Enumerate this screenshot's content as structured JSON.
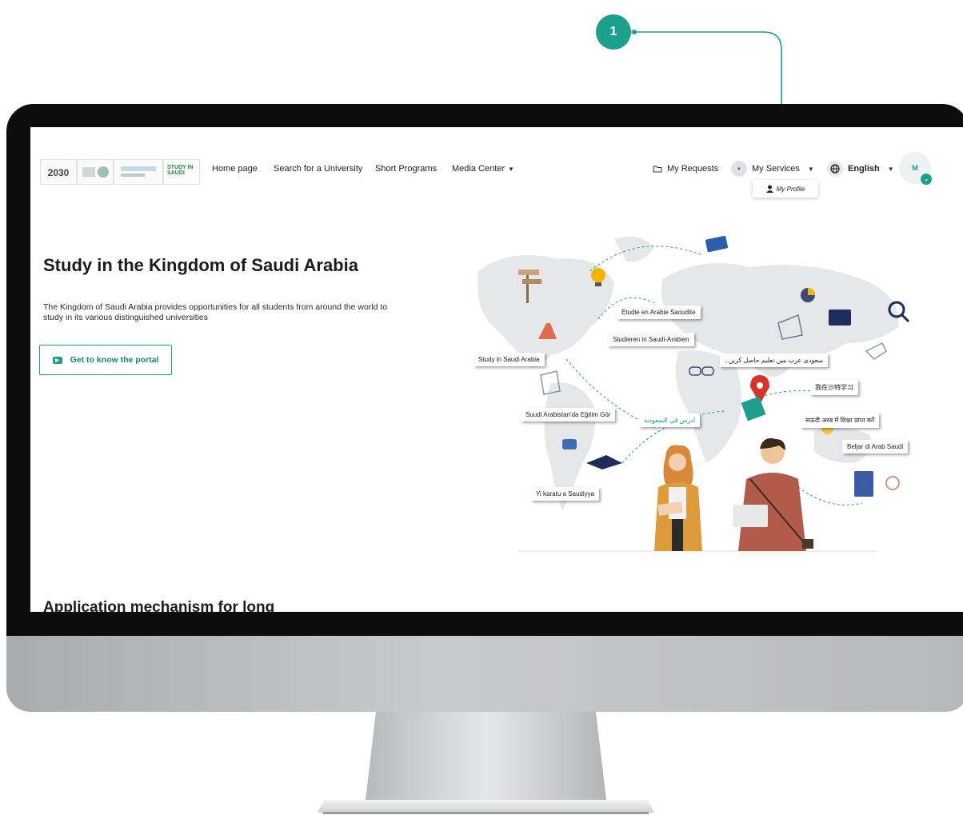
{
  "callout": {
    "number": "1"
  },
  "nav": {
    "logos": [
      "2030",
      "STUDY IN SAUDI"
    ],
    "links": [
      {
        "label": "Home page"
      },
      {
        "label": "Search for a University"
      },
      {
        "label": "Short Programs"
      },
      {
        "label": "Media Center"
      }
    ],
    "my_requests": "My Requests",
    "my_services": "My Services",
    "language": "English",
    "avatar_initial": "M",
    "dropdown_item": "My Profile"
  },
  "hero": {
    "title": "Study in the Kingdom of Saudi Arabia",
    "description": "The Kingdom of Saudi Arabia provides opportunities for all students from around the world to study in its various distinguished universities",
    "cta": "Get to know the portal"
  },
  "section": {
    "heading": "Application mechanism for long"
  },
  "illustration": {
    "tags": [
      "Étudie en Arabie Saoudite",
      "Studieren in Saudi-Arabien",
      "Study in Saudi Arabia",
      "سعودی عرب میں تعلیم حاصل کریں۔",
      "我在沙特学习",
      "Suudi Arabistan'da Eğitim Gör",
      "ادرس في السعودية",
      "सऊदी अरब में शिक्षा प्राप्त करें",
      "Beljar di Arab Saudi",
      "Yi karatu a Saudiyya"
    ]
  },
  "colors": {
    "accent": "#1aa08c",
    "bezel": "#0d0d0d",
    "chin": "#bfc0c2"
  }
}
